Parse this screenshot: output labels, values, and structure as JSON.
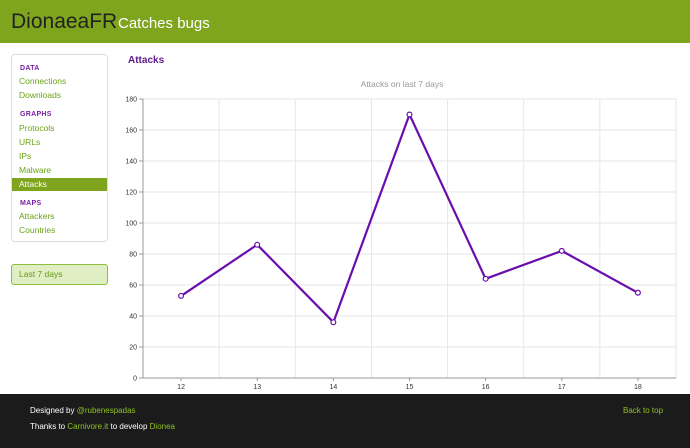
{
  "header": {
    "brand": "DionaeaFR",
    "tagline": "Catches bugs"
  },
  "sidebar": {
    "sections": [
      {
        "title": "DATA",
        "items": [
          {
            "label": "Connections"
          },
          {
            "label": "Downloads"
          }
        ]
      },
      {
        "title": "GRAPHS",
        "items": [
          {
            "label": "Protocols"
          },
          {
            "label": "URLs"
          },
          {
            "label": "IPs"
          },
          {
            "label": "Malware"
          },
          {
            "label": "Attacks",
            "active": true
          }
        ]
      },
      {
        "title": "MAPS",
        "items": [
          {
            "label": "Attackers"
          },
          {
            "label": "Countries"
          }
        ]
      }
    ]
  },
  "range_selector": {
    "label": "Last 7 days"
  },
  "main": {
    "title": "Attacks"
  },
  "chart_data": {
    "type": "line",
    "title": "Attacks on last 7 days",
    "x": [
      12,
      13,
      14,
      15,
      16,
      17,
      18
    ],
    "values": [
      53,
      86,
      36,
      170,
      64,
      82,
      55
    ],
    "ylim": [
      0,
      180
    ],
    "yticks": [
      0,
      20,
      40,
      60,
      80,
      100,
      120,
      140,
      160,
      180
    ],
    "grid": true,
    "line_color": "#6a0dad",
    "xlabel": "",
    "ylabel": ""
  },
  "footer": {
    "designed_prefix": "Designed by ",
    "designed_link": "@rubenespadas",
    "thanks_prefix": "Thanks to ",
    "thanks_link1": "Carnivore.it",
    "thanks_mid": " to develop ",
    "thanks_link2": "Dionea",
    "back_to_top": "Back to top"
  },
  "colors": {
    "header_bg": "#7ea51d",
    "accent_purple": "#5c1a8c",
    "link_green": "#6aa316",
    "footer_bg": "#1b1b1b"
  }
}
